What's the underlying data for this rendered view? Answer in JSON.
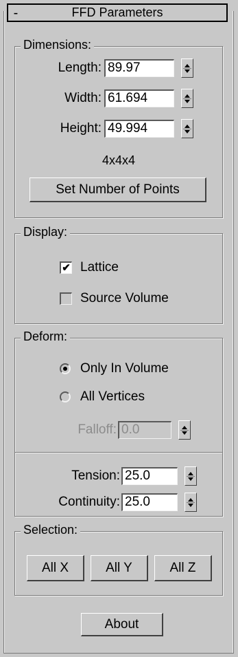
{
  "rollout": {
    "collapse_symbol": "-",
    "title": "FFD Parameters"
  },
  "dimensions": {
    "label": "Dimensions:",
    "length": {
      "label": "Length:",
      "value": "89.97"
    },
    "width": {
      "label": "Width:",
      "value": "61.694"
    },
    "height": {
      "label": "Height:",
      "value": "49.994"
    },
    "points": "4x4x4",
    "set_button": "Set Number of Points"
  },
  "display": {
    "label": "Display:",
    "lattice": {
      "label": "Lattice",
      "checked": true,
      "mark": "✔"
    },
    "source_volume": {
      "label": "Source Volume",
      "checked": false
    }
  },
  "deform": {
    "label": "Deform:",
    "only_in_volume": {
      "label": "Only In Volume",
      "selected": true
    },
    "all_vertices": {
      "label": "All Vertices",
      "selected": false
    },
    "falloff": {
      "label": "Falloff:",
      "value": "0.0",
      "enabled": false
    },
    "tension": {
      "label": "Tension:",
      "value": "25.0"
    },
    "continuity": {
      "label": "Continuity:",
      "value": "25.0"
    }
  },
  "selection": {
    "label": "Selection:",
    "all_x": "All X",
    "all_y": "All Y",
    "all_z": "All Z"
  },
  "about_button": "About"
}
